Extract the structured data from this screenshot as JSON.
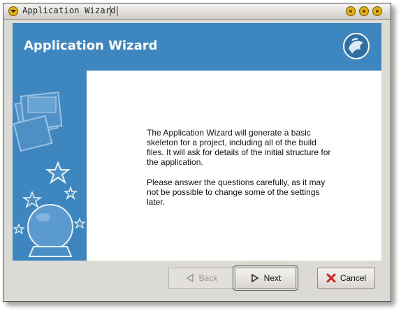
{
  "window": {
    "title": "Application Wizard"
  },
  "banner": {
    "title": "Application Wizard"
  },
  "content": {
    "paragraph1": "The Application Wizard will generate a basic skeleton for a project, including all of the build files. It will ask for details of the initial structure for the application.",
    "paragraph2": "Please answer the questions carefully, as it may not be possible to change some of the settings later."
  },
  "buttons": {
    "back_label": "Back",
    "next_label": "Next",
    "cancel_label": "Cancel",
    "back_enabled": false
  },
  "icons": {
    "back": "left-arrow-icon",
    "next": "right-arrow-icon",
    "cancel": "red-x-icon",
    "logo": "gnome-foot-logo",
    "side_art": [
      "window-frames-art",
      "stars-art",
      "crystal-ball-art"
    ]
  },
  "colors": {
    "banner": "#3d86bf",
    "titlebar_buttons": "#e7b10a",
    "cancel_x": "#d11f1f"
  }
}
